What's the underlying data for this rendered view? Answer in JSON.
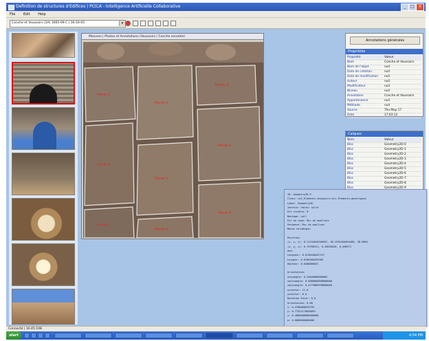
{
  "window": {
    "title": "Definition de structures d'Edifices | PCICA - Intelligence Artificielle Collaborative"
  },
  "menu": {
    "items": [
      "File",
      "Edit",
      "Help"
    ]
  },
  "toolbar": {
    "project_combo": "Conche et Voussoirs (1A) 1665-09-C | 16-10-05"
  },
  "viewer": {
    "title": "Mesures | Photos et Annotations (Voussoirs / Conche annotée)"
  },
  "stone_labels": [
    "Pierre 1",
    "Pierre 2",
    "Pierre 3",
    "Pierre 4",
    "Pierre 5",
    "Pierre 6",
    "Pierre 7",
    "Pierre 8",
    "Pierre 9"
  ],
  "properties": {
    "button": "Annotations générales",
    "header": "Propriétés",
    "columns": [
      "Propriété",
      "Valeur"
    ],
    "rows": [
      {
        "k": "Nom",
        "v": "Conche et Voussoirs"
      },
      {
        "k": "Nom de l'objet",
        "v": "null"
      },
      {
        "k": "Date de création",
        "v": "null"
      },
      {
        "k": "Date de modification",
        "v": "null"
      },
      {
        "k": "Auteur",
        "v": "null"
      },
      {
        "k": "Modificateur",
        "v": "null"
      },
      {
        "k": "Niveau",
        "v": "null"
      },
      {
        "k": "Annotation",
        "v": "Conche et Voussoirs"
      },
      {
        "k": "Appartenance",
        "v": "null"
      },
      {
        "k": "Méthode",
        "v": "null"
      },
      {
        "k": "Source",
        "v": "Thu May 17"
      },
      {
        "k": "Date",
        "v": "17:03:12"
      }
    ]
  },
  "list_panel": {
    "header": "Calques",
    "columns": [
      "Nom",
      "Valeur"
    ],
    "rows": [
      {
        "k": "Bloc",
        "v": "Geometry2D-0"
      },
      {
        "k": "Bloc",
        "v": "Geometry2D-1"
      },
      {
        "k": "Bloc",
        "v": "Geometry2D-2"
      },
      {
        "k": "Bloc",
        "v": "Geometry2D-3"
      },
      {
        "k": "Bloc",
        "v": "Geometry2D-4"
      },
      {
        "k": "Bloc",
        "v": "Geometry2D-5"
      },
      {
        "k": "Bloc",
        "v": "Geometry2D-6"
      },
      {
        "k": "Bloc",
        "v": "Geometry2D-7"
      },
      {
        "k": "Bloc",
        "v": "Geometry2D-8"
      },
      {
        "k": "Bloc",
        "v": "Geometry2D-9"
      }
    ]
  },
  "info_popup": {
    "lines": [
      "ID: Geometry2D-5",
      "Class: Lot_Elements.Voussoirs.Arc.Elements.generiques",
      "Label: Geometry2D",
      "Inertie: Valeur nulle",
      "Est visible: 0",
      "Montage: null",
      "Est du type: Mur de moellons",
      "Pendance: Mur de moellons",
      "Masse volumique:",
      "",
      "Position:",
      "  (x, y, z): 0.21194626300567, 85.2952450094486, 38.9864",
      "  (x, y, z): 0.79768311, 0.49828426, 0.498571",
      "Axe:",
      "  Longueur: 0.0136440447127",
      "  Largeur: 0.0766468455389",
      "  Hauteur: 0.0188680021",
      "",
      "Orientation:",
      "  xxxxangle: 0.24840000000002",
      "  xaxisangle: 0.0000000000000000",
      "  zaxisangle: 0.4779889990000000",
      "  xzvector: 11.0",
      "  yzvector: 0.0",
      "  Rotation Euler: 0.0",
      "  Orientation: 0.00",
      "  x: 0.4780000078793",
      "  y: 0.77522170646091",
      "  z: 0.4000000000000000",
      "  w: 0.0000000000000"
    ]
  },
  "statusbar": {
    "text": "Connecté | 16:45:108"
  },
  "taskbar": {
    "start_label": "start",
    "clock": "4:54 PM"
  }
}
